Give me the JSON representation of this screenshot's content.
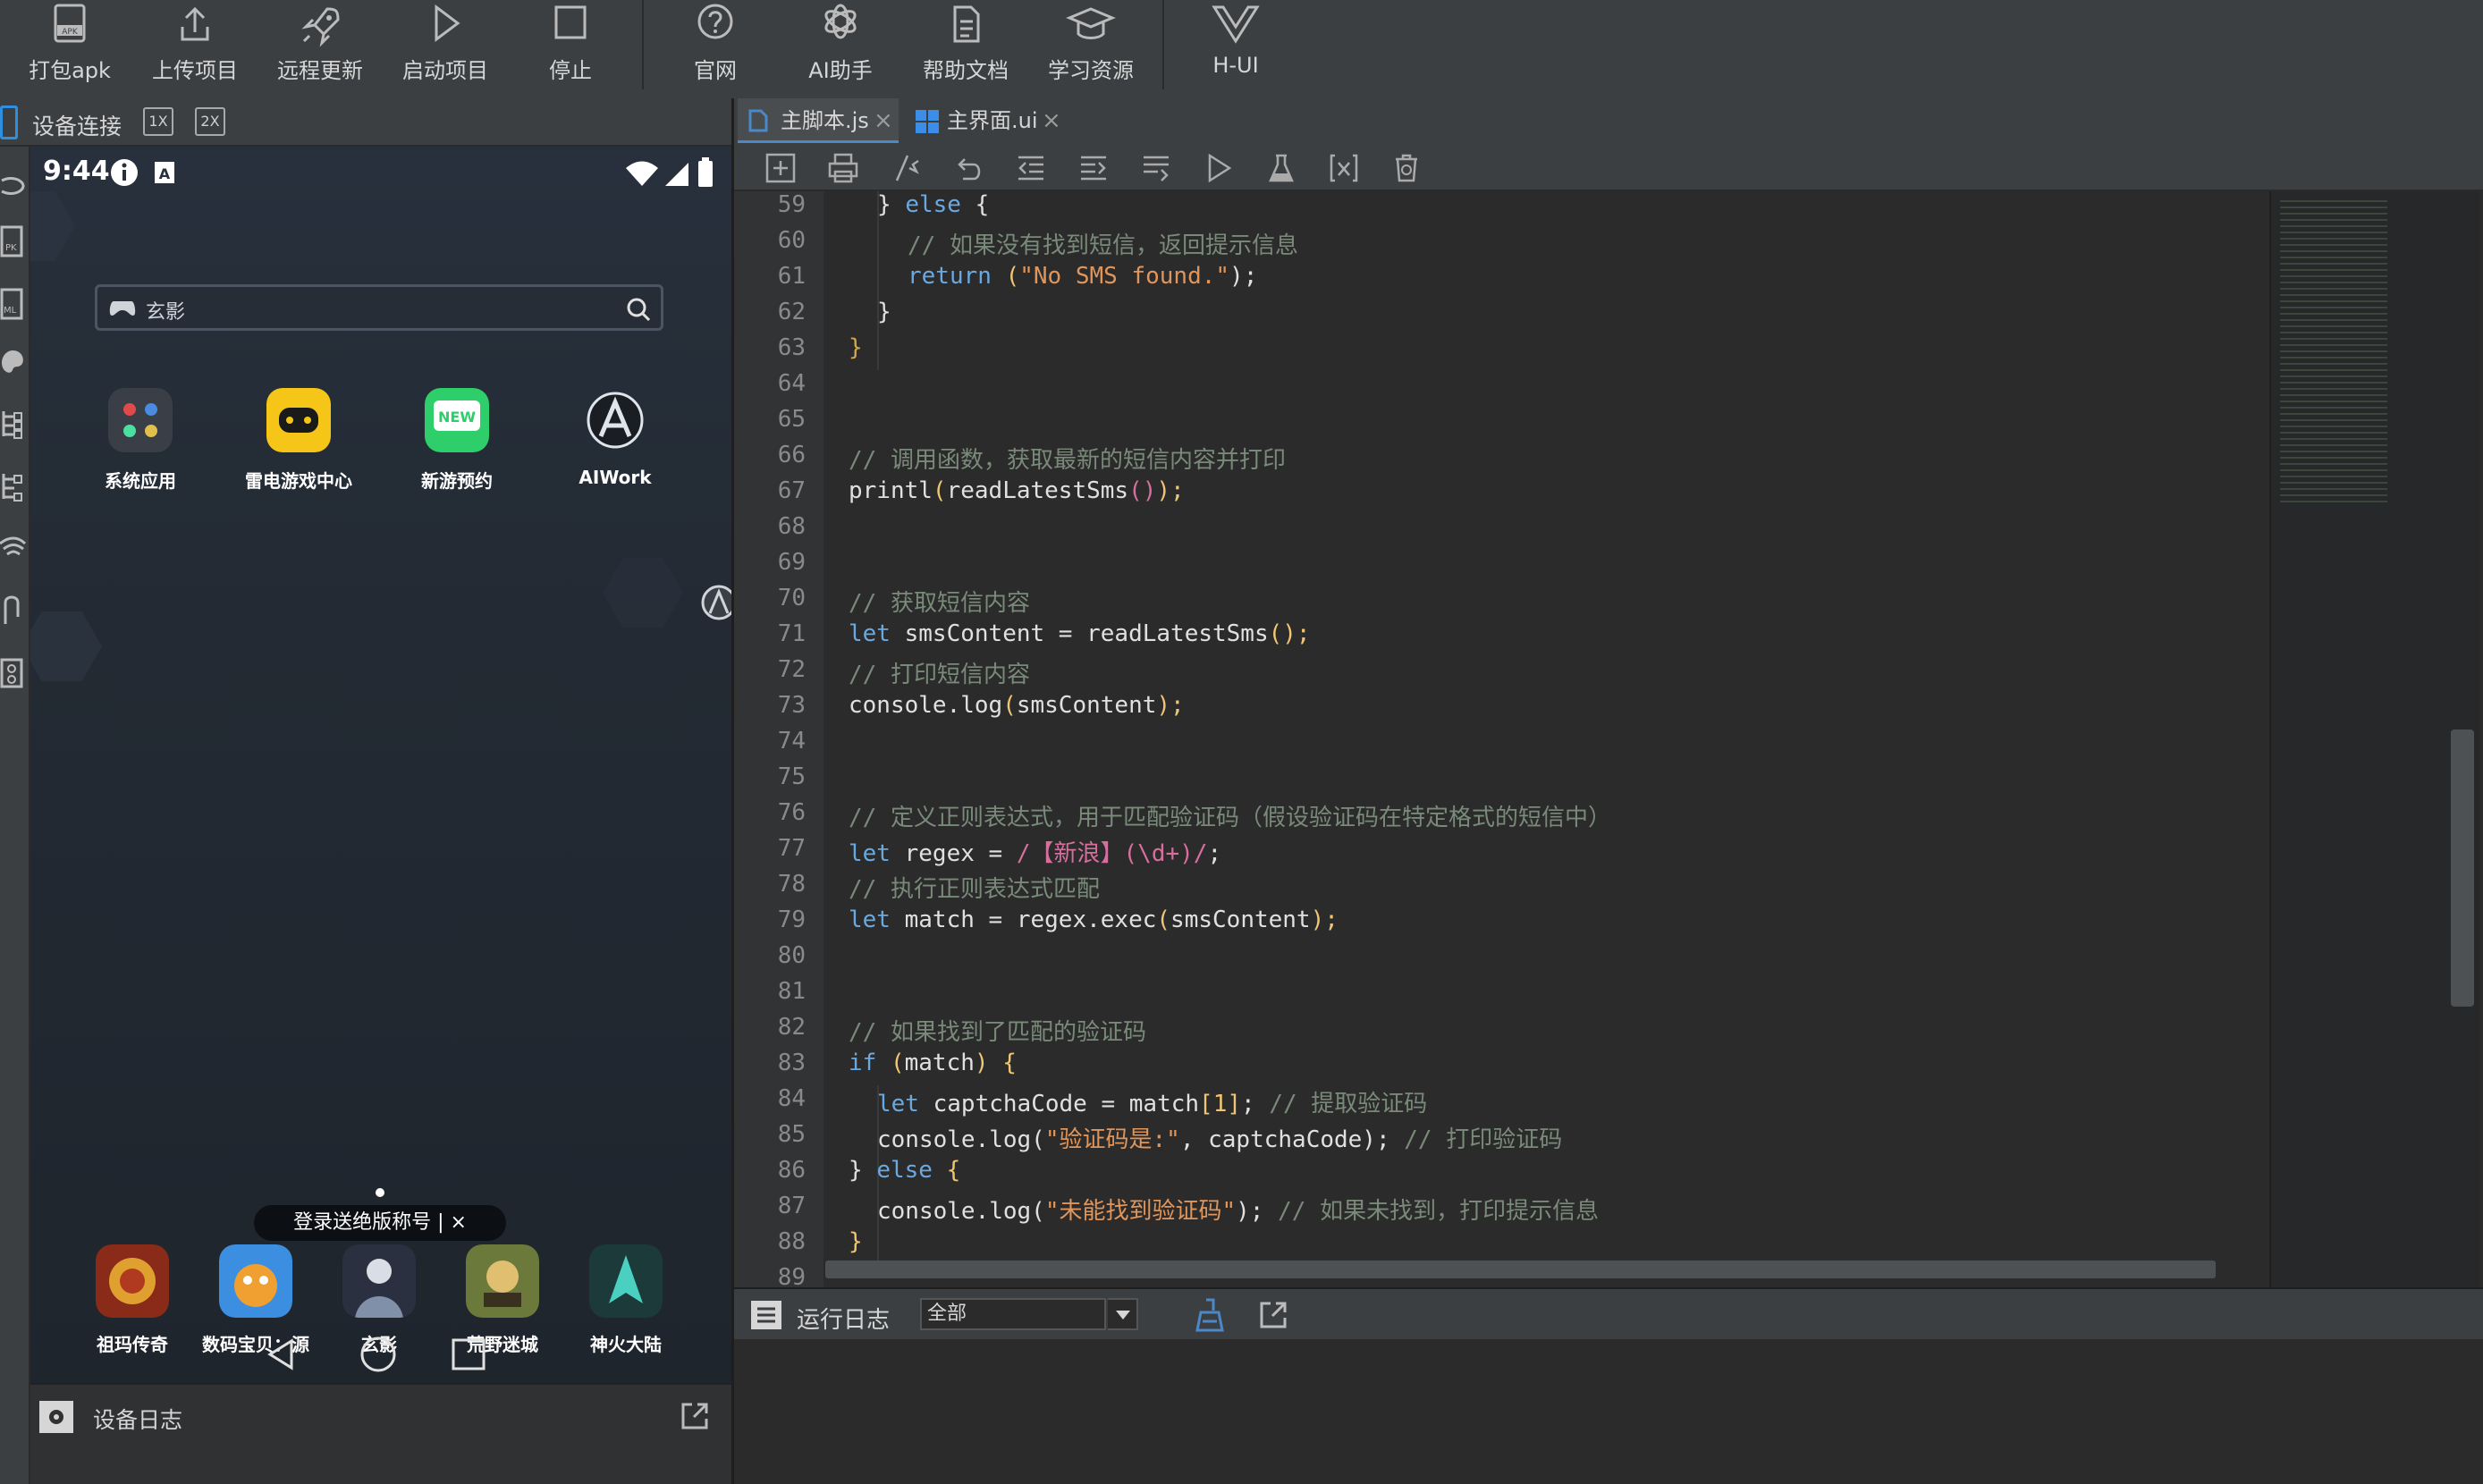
{
  "toolbar": {
    "buttons": [
      {
        "label": "打包apk",
        "icon": "apk-package-icon"
      },
      {
        "label": "上传项目",
        "icon": "upload-icon"
      },
      {
        "label": "远程更新",
        "icon": "rocket-icon"
      },
      {
        "label": "启动项目",
        "icon": "play-icon"
      },
      {
        "label": "停止",
        "icon": "stop-icon"
      },
      {
        "label": "官网",
        "icon": "help-circle-icon"
      },
      {
        "label": "AI助手",
        "icon": "ai-openai-icon"
      },
      {
        "label": "帮助文档",
        "icon": "document-icon"
      },
      {
        "label": "学习资源",
        "icon": "graduation-cap-icon"
      },
      {
        "label": "H-UI",
        "icon": "vue-logo-icon"
      }
    ]
  },
  "device_panel": {
    "title": "设备连接",
    "zoom_1x": "1X",
    "zoom_2x": "2X",
    "side_icons": [
      "link-icon",
      "apk-icon",
      "xml-icon",
      "palette-icon",
      "tree-icon",
      "tree-alt-icon",
      "wifi-icon",
      "usb-icon",
      "settings-icon"
    ],
    "log_title": "设备日志"
  },
  "phone": {
    "status_time": "9:44",
    "search_text": "玄影",
    "apps": [
      {
        "label": "系统应用"
      },
      {
        "label": "雷电游戏中心"
      },
      {
        "label": "新游预约"
      },
      {
        "label": "AIWork"
      }
    ],
    "promo_text": "登录送绝版称号 | ×",
    "new_badge": "NEW",
    "dock": [
      {
        "label": "祖玛传奇"
      },
      {
        "label": "数码宝贝：源"
      },
      {
        "label": "玄影"
      },
      {
        "label": "荒野迷城"
      },
      {
        "label": "神火大陆"
      }
    ]
  },
  "editor": {
    "tabs": [
      {
        "label": "主脚本.js",
        "active": true
      },
      {
        "label": "主界面.ui",
        "active": false
      }
    ],
    "toolbar_icons": [
      "add-file-icon",
      "print-icon",
      "comment-icon",
      "undo-icon",
      "indent-left-icon",
      "indent-right-icon",
      "format-icon",
      "run-icon",
      "flask-icon",
      "variable-icon",
      "clear-icon"
    ],
    "line_numbers": [
      "59",
      "60",
      "61",
      "62",
      "63",
      "64",
      "65",
      "66",
      "67",
      "68",
      "69",
      "70",
      "71",
      "72",
      "73",
      "74",
      "75",
      "76",
      "77",
      "78",
      "79",
      "80",
      "81",
      "82",
      "83",
      "84",
      "85",
      "86",
      "87",
      "88",
      "89"
    ],
    "code": {
      "l59_a": "} ",
      "l59_b": "else",
      "l59_c": " {",
      "l60": "// 如果没有找到短信，返回提示信息",
      "l61_a": "return",
      "l61_b": " (",
      "l61_c": "\"No SMS found.\"",
      "l61_d": ");",
      "l62": "}",
      "l63": "}",
      "l66": "// 调用函数，获取最新的短信内容并打印",
      "l67_a": "printl",
      "l67_b": "(",
      "l67_c": "readLatestSms",
      "l67_d": "()",
      "l67_e": ");",
      "l70": "// 获取短信内容",
      "l71_a": "let",
      "l71_b": " smsContent = readLatestSms",
      "l71_c": "();",
      "l72": "// 打印短信内容",
      "l73_a": "console.log",
      "l73_b": "(",
      "l73_c": "smsContent",
      "l73_d": ");",
      "l76": "// 定义正则表达式，用于匹配验证码（假设验证码在特定格式的短信中）",
      "l77_a": "let",
      "l77_b": " regex = ",
      "l77_c": "/【新浪】(\\d+)/",
      "l77_d": ";",
      "l78": "// 执行正则表达式匹配",
      "l79_a": "let",
      "l79_b": " match = regex.exec",
      "l79_c": "(",
      "l79_d": "smsContent",
      "l79_e": ");",
      "l82": "// 如果找到了匹配的验证码",
      "l83_a": "if",
      "l83_b": " (",
      "l83_c": "match",
      "l83_d": ") {",
      "l84_a": "let",
      "l84_b": " captchaCode = match",
      "l84_c": "[1]",
      "l84_d": "; ",
      "l84_e": "// 提取验证码",
      "l85_a": "console.log(",
      "l85_b": "\"验证码是:\"",
      "l85_c": ", captchaCode); ",
      "l85_d": "// 打印验证码",
      "l86_a": "} ",
      "l86_b": "else",
      "l86_c": " {",
      "l87_a": "console.log(",
      "l87_b": "\"未能找到验证码\"",
      "l87_c": "); ",
      "l87_d": "// 如果未找到，打印提示信息",
      "l88": "}"
    }
  },
  "run_log": {
    "title": "运行日志",
    "filter_value": "全部"
  },
  "colors": {
    "accent": "#4a88c7",
    "keyword": "#6aa8e0",
    "comment": "#7a8a7a",
    "string": "#e0955a",
    "regex": "#d76f9e"
  }
}
